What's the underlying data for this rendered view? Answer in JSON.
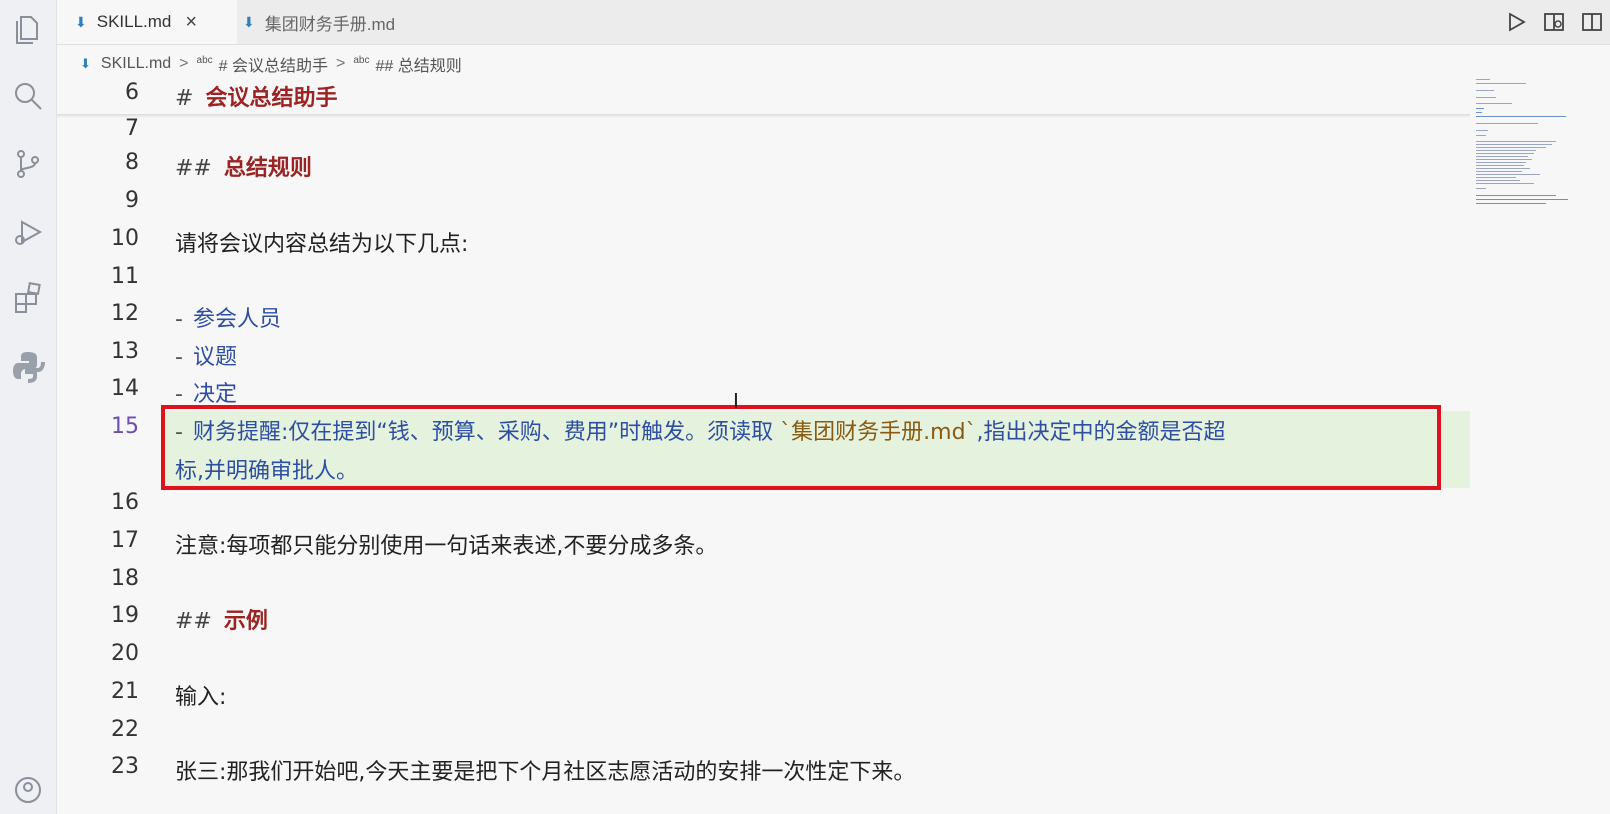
{
  "tabs": [
    {
      "label": "SKILL.md",
      "active": true,
      "close": "×"
    },
    {
      "label": "集团财务手册.md",
      "active": false
    }
  ],
  "breadcrumb": {
    "file": "SKILL.md",
    "sep": ">",
    "abc": "abc",
    "item1": "# 会议总结助手",
    "item2": "## 总结规则"
  },
  "icons": {
    "activity": [
      "files-icon",
      "search-icon",
      "source-control-icon",
      "run-debug-icon",
      "extensions-icon",
      "python-icon",
      "account-icon"
    ],
    "toolbar": [
      "run-icon",
      "open-preview-side-icon",
      "split-editor-icon"
    ],
    "file": "markdown-file-icon"
  },
  "colors": {
    "heading": "#9b2323",
    "list": "#2e4ea3",
    "code": "#8a5a12",
    "highlight_border": "#e0121c",
    "highlight_bg": "#e5f3de",
    "active_line_number": "#6c4fb3"
  },
  "editor": {
    "lines": [
      {
        "n": "6",
        "hash": "#",
        "heading": "会议总结助手"
      },
      {
        "n": "7"
      },
      {
        "n": "8",
        "hash": "##",
        "heading": "总结规则"
      },
      {
        "n": "9"
      },
      {
        "n": "10",
        "text": "请将会议内容总结为以下几点:"
      },
      {
        "n": "11"
      },
      {
        "n": "12",
        "bullet": "-",
        "item": "参会人员"
      },
      {
        "n": "13",
        "bullet": "-",
        "item": "议题"
      },
      {
        "n": "14",
        "bullet": "-",
        "item": "决定"
      },
      {
        "n": "15",
        "bullet": "-",
        "item_before": "财务提醒:仅在提到“钱、预算、采购、费用”时触发。须读取 ",
        "code": "`集团财务手册.md`",
        "item_after": ",指出决定中的金额是否超",
        "wrap": "标,并明确审批人。"
      },
      {
        "n": "16"
      },
      {
        "n": "17",
        "text": "注意:每项都只能分别使用一句话来表述,不要分成多条。"
      },
      {
        "n": "18"
      },
      {
        "n": "19",
        "hash": "##",
        "heading": "示例"
      },
      {
        "n": "20"
      },
      {
        "n": "21",
        "text": "输入:"
      },
      {
        "n": "22"
      },
      {
        "n": "23",
        "text": "张三:那我们开始吧,今天主要是把下个月社区志愿活动的安排一次性定下来。"
      }
    ]
  }
}
